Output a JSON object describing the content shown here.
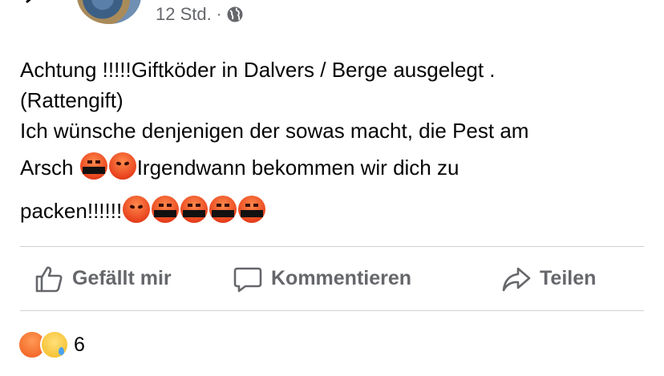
{
  "header": {
    "timestamp": "12 Std.",
    "separator": "·",
    "privacy_icon": "globe-icon"
  },
  "post": {
    "lines": [
      "Achtung !!!!!Giftköder in Dalvers / Berge ausgelegt .",
      "(Rattengift)",
      "Ich wünsche denjenigen der sowas macht, die Pest am",
      "Arsch ",
      "Irgendwann bekommen wir dich zu",
      "packen!!!!!!"
    ],
    "emoji": {
      "line4": [
        "face-with-symbols-on-mouth",
        "pouting-face"
      ],
      "line5": [
        "pouting-face",
        "face-with-symbols-on-mouth",
        "face-with-symbols-on-mouth",
        "face-with-symbols-on-mouth",
        "face-with-symbols-on-mouth"
      ]
    }
  },
  "actions": {
    "like_label": "Gefällt mir",
    "comment_label": "Kommentieren",
    "share_label": "Teilen"
  },
  "reactions": {
    "types": [
      "angry",
      "sad"
    ],
    "count": "6"
  }
}
